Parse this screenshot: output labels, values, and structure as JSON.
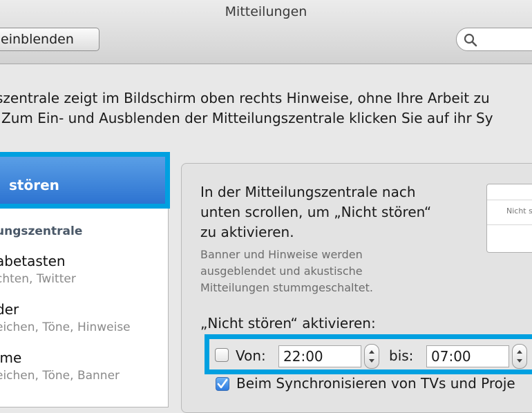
{
  "window": {
    "title": "Mitteilungen"
  },
  "toolbar": {
    "show_all_label": "einblenden"
  },
  "description": {
    "line1": "szentrale zeigt im Bildschirm oben rechts Hinweise, ohne Ihre Arbeit zu",
    "line2": "Zum Ein- und Ausblenden der Mitteilungszentrale klicken Sie auf ihr Sy"
  },
  "sidebar": {
    "selected_label": "stören",
    "heading": "ungszentrale",
    "items": [
      {
        "title": "abetasten",
        "subtitle": "chten, Twitter"
      },
      {
        "title": "der",
        "subtitle": "eichen, Töne, Hinweise"
      },
      {
        "title": "ime",
        "subtitle": "eichen, Töne, Banner"
      }
    ]
  },
  "detail": {
    "intro_lines": [
      "In der Mitteilungszentrale nach",
      "unten scrollen, um „Nicht stören“",
      "zu aktivieren."
    ],
    "sub_lines": [
      "Banner und Hinweise werden",
      "ausgeblendet und akustische",
      "Mitteilungen stummgeschaltet."
    ],
    "preview_text": "Nicht s",
    "activate_label": "„Nicht stören“ aktivieren:",
    "schedule": {
      "from_label": "Von:",
      "from_value": "22:00",
      "to_label": "bis:",
      "to_value": "07:00",
      "enabled": false
    },
    "sync_label": "Beim Synchronisieren von TVs und Proje",
    "sync_checked": true
  },
  "colors": {
    "highlight": "#00a0e0",
    "selection": "#2d73d1"
  }
}
